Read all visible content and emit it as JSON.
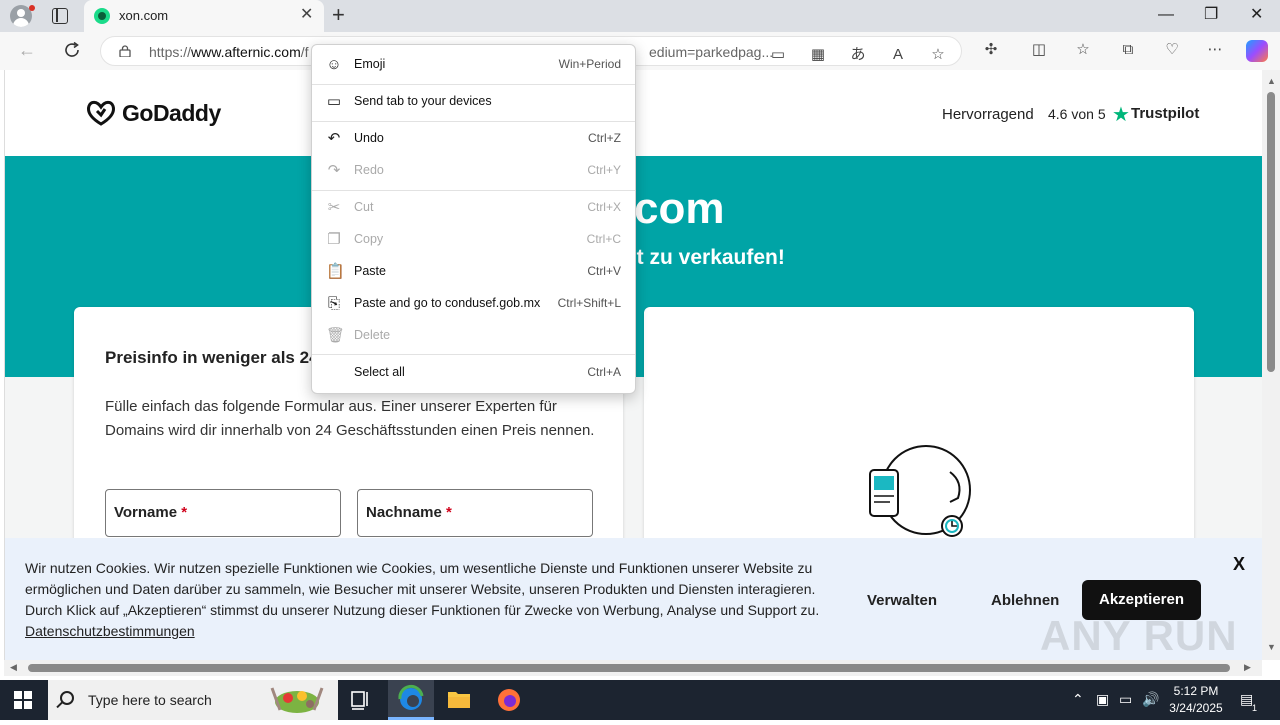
{
  "browser": {
    "tab_title": "xon.com",
    "url_prefix": "https://",
    "url_domain": "www.afternic.com",
    "url_rest": "/f",
    "url_tail": "edium=parkedpag...",
    "window_controls": {
      "minimize": "—",
      "maximize": "❐",
      "close": "✕"
    }
  },
  "site": {
    "logo": "GoDaddy",
    "rating_label": "Hervorragend",
    "rating_value": "4.6 von 5",
    "trustpilot": "Trustpilot",
    "hero_title": "com",
    "hero_subtitle": "st zu verkaufen!",
    "form": {
      "heading": "Preisinfo in weniger als 24",
      "intro": "Fülle einfach das folgende Formular aus. Einer unserer Experten für Domains wird dir innerhalb von 24 Geschäftsstunden einen Preis nennen.",
      "first_name_label": "Vorname",
      "last_name_label": "Nachname",
      "required_mark": "*"
    }
  },
  "cookie_banner": {
    "text": "Wir nutzen Cookies. Wir nutzen spezielle Funktionen wie Cookies, um wesentliche Dienste und Funktionen unserer Website zu ermöglichen und Daten darüber zu sammeln, wie Besucher mit unserer Website, unseren Produkten und Diensten interagieren. Durch Klick auf „Akzeptieren“ stimmst du unserer Nutzung dieser Funktionen für Zwecke von Werbung, Analyse und Support zu.",
    "link": "Datenschutzbestimmungen",
    "close": "X",
    "manage": "Verwalten",
    "reject": "Ablehnen",
    "accept": "Akzeptieren"
  },
  "context_menu": {
    "items": [
      {
        "label": "Emoji",
        "shortcut": "Win+Period",
        "icon": "emoji-icon"
      },
      {
        "label": "Send tab to your devices",
        "shortcut": "",
        "icon": "send-tab-icon"
      },
      {
        "label": "Undo",
        "shortcut": "Ctrl+Z",
        "icon": "undo-icon"
      },
      {
        "label": "Redo",
        "shortcut": "Ctrl+Y",
        "icon": "redo-icon",
        "disabled": true
      },
      {
        "label": "Cut",
        "shortcut": "Ctrl+X",
        "icon": "cut-icon",
        "disabled": true
      },
      {
        "label": "Copy",
        "shortcut": "Ctrl+C",
        "icon": "copy-icon",
        "disabled": true
      },
      {
        "label": "Paste",
        "shortcut": "Ctrl+V",
        "icon": "paste-icon"
      },
      {
        "label": "Paste and go to condusef.gob.mx",
        "shortcut": "Ctrl+Shift+L",
        "icon": "paste-go-icon"
      },
      {
        "label": "Delete",
        "shortcut": "",
        "icon": "delete-icon",
        "disabled": true
      },
      {
        "label": "Select all",
        "shortcut": "Ctrl+A",
        "icon": ""
      }
    ]
  },
  "watermark": "ANY RUN",
  "taskbar": {
    "search_placeholder": "Type here to search",
    "time": "5:12 PM",
    "date": "3/24/2025",
    "notification_count": "1"
  },
  "colors": {
    "hero_teal": "#00a4a6",
    "taskbar": "#1c2430",
    "accept_button": "#111111",
    "trustpilot_green": "#00b67a"
  }
}
